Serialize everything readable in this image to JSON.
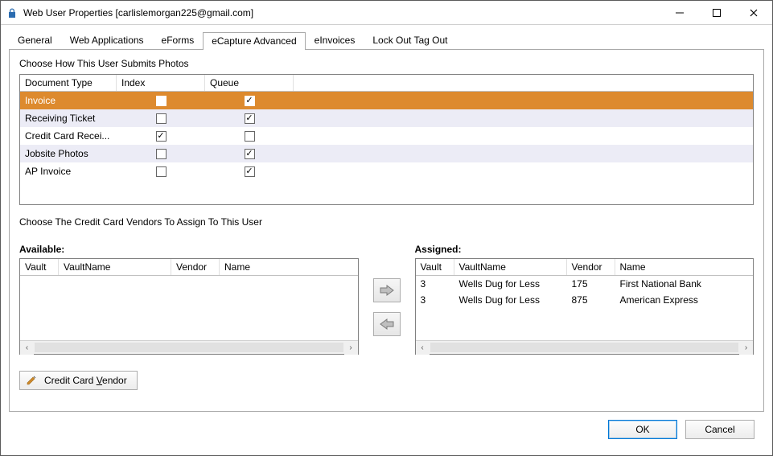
{
  "window": {
    "title": "Web User Properties [carlislemorgan225@gmail.com]"
  },
  "tabs": {
    "items": [
      "General",
      "Web Applications",
      "eForms",
      "eCapture Advanced",
      "eInvoices",
      "Lock Out Tag Out"
    ],
    "active_index": 3
  },
  "photos_section": {
    "label": "Choose How This User Submits Photos",
    "headers": {
      "doc": "Document Type",
      "index": "Index",
      "queue": "Queue"
    },
    "rows": [
      {
        "doc": "Invoice",
        "index": false,
        "queue": true,
        "selected": true
      },
      {
        "doc": "Receiving Ticket",
        "index": false,
        "queue": true,
        "alt": true
      },
      {
        "doc": "Credit Card Recei...",
        "index": true,
        "queue": false
      },
      {
        "doc": "Jobsite Photos",
        "index": false,
        "queue": true,
        "alt": true
      },
      {
        "doc": "AP Invoice",
        "index": false,
        "queue": true
      }
    ]
  },
  "vendors_section": {
    "label": "Choose The Credit Card Vendors To Assign To This User",
    "available": {
      "label": "Available:",
      "headers": [
        "Vault",
        "VaultName",
        "Vendor",
        "Name"
      ],
      "rows": []
    },
    "assigned": {
      "label": "Assigned:",
      "headers": [
        "Vault",
        "VaultName",
        "Vendor",
        "Name"
      ],
      "rows": [
        {
          "vault": "3",
          "vaultName": "Wells Dug for Less",
          "vendor": "175",
          "name": "First National Bank"
        },
        {
          "vault": "3",
          "vaultName": "Wells Dug for Less",
          "vendor": "875",
          "name": "American Express"
        }
      ]
    }
  },
  "buttons": {
    "credit_card_vendor": "Credit Card Vendor",
    "ok": "OK",
    "cancel": "Cancel"
  }
}
